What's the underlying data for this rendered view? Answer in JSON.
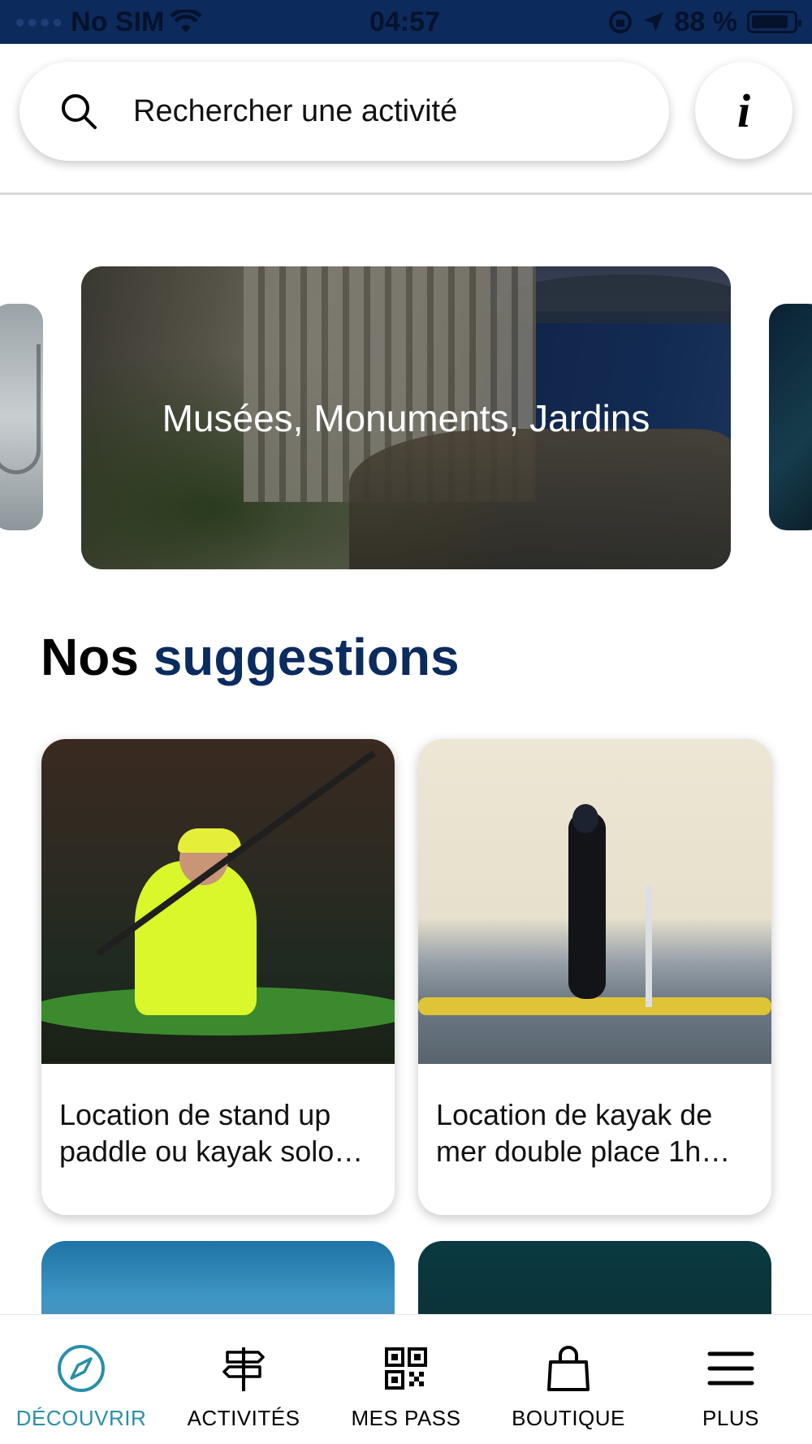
{
  "status_bar": {
    "carrier": "No SIM",
    "time": "04:57",
    "battery_percent": "88 %",
    "battery_level": 0.88
  },
  "search": {
    "placeholder": "Rechercher une activité"
  },
  "info_button": {
    "label": "i"
  },
  "carousel": {
    "active_title": "Musées, Monuments, Jardins"
  },
  "suggestions": {
    "title_part1": "Nos",
    "title_part2": "suggestions",
    "cards": [
      {
        "title": "Location de stand up paddle ou kayak solo…"
      },
      {
        "title": "Location de kayak de mer double place 1h…"
      }
    ]
  },
  "tab_bar": {
    "active_color": "#2a8fa8",
    "tabs": [
      {
        "label": "DÉCOUVRIR",
        "icon": "compass-icon",
        "active": true
      },
      {
        "label": "ACTIVITÉS",
        "icon": "signpost-icon",
        "active": false
      },
      {
        "label": "MES PASS",
        "icon": "qr-code-icon",
        "active": false
      },
      {
        "label": "BOUTIQUE",
        "icon": "shopping-bag-icon",
        "active": false
      },
      {
        "label": "PLUS",
        "icon": "menu-icon",
        "active": false
      }
    ]
  },
  "colors": {
    "status_bar_bg": "#0d2a5c",
    "title_accent": "#0c2b5e"
  }
}
